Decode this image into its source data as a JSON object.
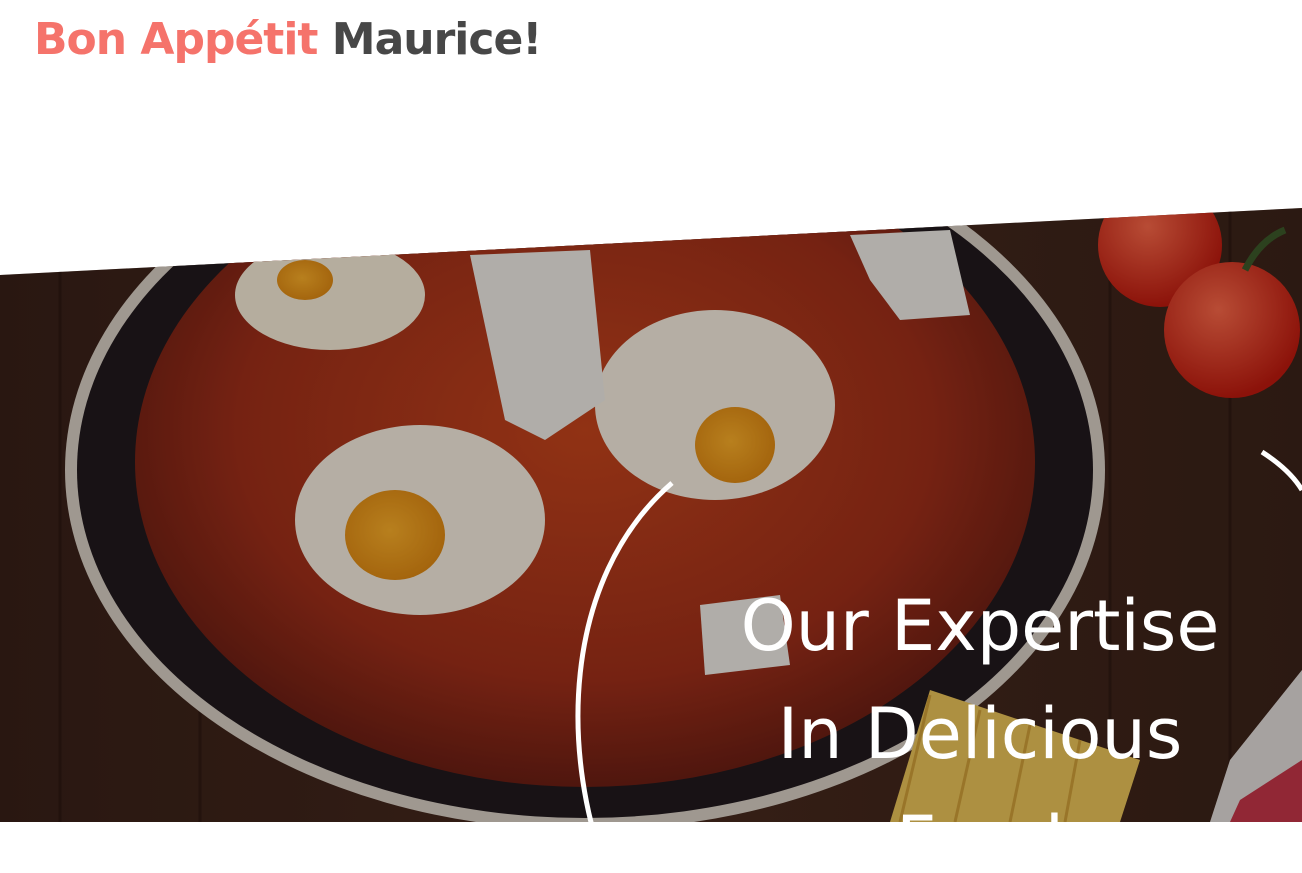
{
  "brand": {
    "part1": "Bon Appétit",
    "part2": "Maurice!"
  },
  "hero": {
    "title_line1": "Our Expertise",
    "title_line2": "In Delicious",
    "title_line3": "Food"
  },
  "colors": {
    "brand_accent": "#f5736b",
    "brand_dark": "#474747",
    "hero_text": "#ffffff"
  }
}
